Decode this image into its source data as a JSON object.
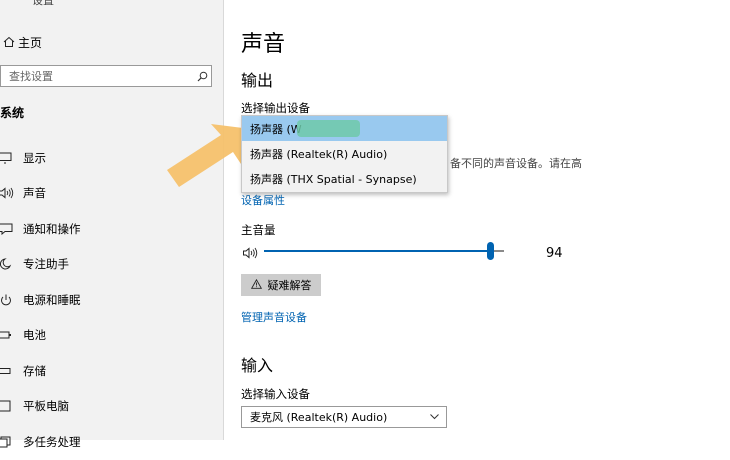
{
  "sidebar": {
    "window_title": "设置",
    "home_label": "主页",
    "search_placeholder": "查找设置",
    "section_title": "系统",
    "items": [
      {
        "label": "显示",
        "icon": "monitor-icon"
      },
      {
        "label": "声音",
        "icon": "speaker-icon"
      },
      {
        "label": "通知和操作",
        "icon": "notification-icon"
      },
      {
        "label": "专注助手",
        "icon": "moon-icon"
      },
      {
        "label": "电源和睡眠",
        "icon": "power-icon"
      },
      {
        "label": "电池",
        "icon": "battery-icon"
      },
      {
        "label": "存储",
        "icon": "storage-icon"
      },
      {
        "label": "平板电脑",
        "icon": "tablet-icon"
      },
      {
        "label": "多任务处理",
        "icon": "multitask-icon"
      }
    ]
  },
  "main": {
    "title": "声音",
    "output": {
      "heading": "输出",
      "select_label": "选择输出设备",
      "partial_text": "备不同的声音设备。请在高",
      "properties_link": "设备属性",
      "master_volume_label": "主音量",
      "volume_value": "94",
      "volume_level_percent": 94,
      "troubleshoot_label": "疑难解答",
      "manage_link": "管理声音设备"
    },
    "input": {
      "heading": "输入",
      "select_label": "选择输入设备",
      "selected_device": "麦克风 (Realtek(R) Audio)"
    }
  },
  "dropdown": {
    "options": [
      {
        "label": "扬声器 (W",
        "selected": true
      },
      {
        "label": "扬声器 (Realtek(R) Audio)",
        "selected": false
      },
      {
        "label": "扬声器 (THX Spatial - Synapse)",
        "selected": false
      }
    ]
  },
  "colors": {
    "accent": "#0063b1",
    "selected_bg": "#99c9ef",
    "arrow": "#f5c16c",
    "sidebar_bg": "#f2f2f2"
  }
}
